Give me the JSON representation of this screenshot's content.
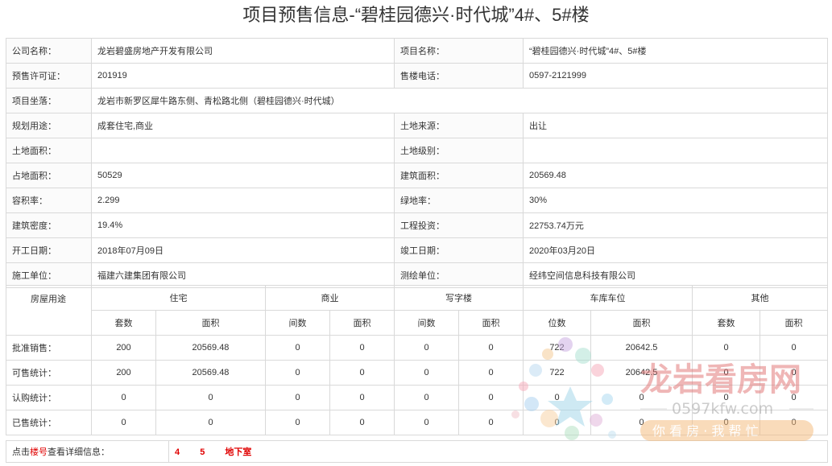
{
  "page_title": "项目预售信息-“碧桂园德兴·时代城”4#、5#楼",
  "info": {
    "company_label": "公司名称：",
    "company_value": "龙岩碧盛房地产开发有限公司",
    "project_label": "项目名称：",
    "project_value": "“碧桂园德兴·时代城”4#、5#楼",
    "permit_label": "预售许可证：",
    "permit_value": "201919",
    "phone_label": "售楼电话：",
    "phone_value": "0597-2121999",
    "location_label": "项目坐落：",
    "location_value": "龙岩市新罗区犀牛路东侧、青松路北侧（碧桂园德兴·时代城）",
    "planning_label": "规划用途：",
    "planning_value": "成套住宅,商业",
    "land_source_label": "土地来源：",
    "land_source_value": "出让",
    "land_area_label": "土地面积：",
    "land_area_value": "",
    "land_grade_label": "土地级别：",
    "land_grade_value": "",
    "site_area_label": "占地面积：",
    "site_area_value": "50529",
    "build_area_label": "建筑面积：",
    "build_area_value": "20569.48",
    "plot_ratio_label": "容积率：",
    "plot_ratio_value": "2.299",
    "green_label": "绿地率：",
    "green_value": "30%",
    "density_label": "建筑密度：",
    "density_value": "19.4%",
    "investment_label": "工程投资：",
    "investment_value": "22753.74万元",
    "start_label": "开工日期：",
    "start_value": "2018年07月09日",
    "finish_label": "竣工日期：",
    "finish_value": "2020年03月20日",
    "builder_label": "施工单位：",
    "builder_value": "福建六建集团有限公司",
    "surveyor_label": "测绘单位：",
    "surveyor_value": "经纬空间信息科技有限公司"
  },
  "sales": {
    "usage_label": "房屋用途",
    "groups": [
      "住宅",
      "商业",
      "写字楼",
      "车库车位",
      "其他"
    ],
    "sub": [
      "套数",
      "面积",
      "间数",
      "面积",
      "间数",
      "面积",
      "位数",
      "面积",
      "套数",
      "面积"
    ],
    "rows": [
      {
        "label": "批准销售：",
        "cells": [
          "200",
          "20569.48",
          "0",
          "0",
          "0",
          "0",
          "722",
          "20642.5",
          "0",
          "0"
        ]
      },
      {
        "label": "可售统计：",
        "cells": [
          "200",
          "20569.48",
          "0",
          "0",
          "0",
          "0",
          "722",
          "20642.5",
          "0",
          "0"
        ]
      },
      {
        "label": "认购统计：",
        "cells": [
          "0",
          "0",
          "0",
          "0",
          "0",
          "0",
          "0",
          "0",
          "0",
          "0"
        ]
      },
      {
        "label": "已售统计：",
        "cells": [
          "0",
          "0",
          "0",
          "0",
          "0",
          "0",
          "0",
          "0",
          "0",
          "0"
        ]
      }
    ]
  },
  "footer": {
    "prompt_a": "点击",
    "prompt_b": "楼号",
    "prompt_c": "查看详细信息：",
    "links": [
      "4",
      "5",
      "地下室"
    ]
  },
  "watermark": {
    "brand": "龙岩看房网",
    "url": "0597kfw.com",
    "slogan": "你 看 房 · 我 帮 忙"
  }
}
